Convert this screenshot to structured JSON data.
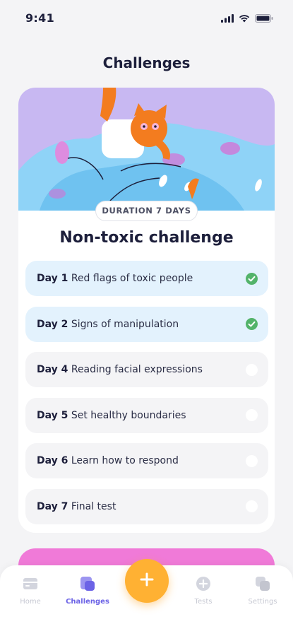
{
  "status_bar": {
    "time": "9:41",
    "icons": [
      "signal-icon",
      "wifi-icon",
      "battery-icon"
    ]
  },
  "header": {
    "title": "Challenges"
  },
  "challenge": {
    "duration_label": "DURATION 7 DAYS",
    "title": "Non-toxic challenge",
    "days": [
      {
        "day": "Day 1",
        "title": "Red flags of toxic people",
        "completed": true
      },
      {
        "day": "Day 2",
        "title": "Signs of manipulation",
        "completed": true
      },
      {
        "day": "Day 4",
        "title": "Reading facial expressions",
        "completed": false
      },
      {
        "day": "Day 5",
        "title": "Set healthy boundaries",
        "completed": false
      },
      {
        "day": "Day 6",
        "title": "Learn how to respond",
        "completed": false
      },
      {
        "day": "Day 7",
        "title": "Final test",
        "completed": false
      }
    ]
  },
  "tab_bar": {
    "tabs": [
      {
        "label": "Home",
        "icon": "home-icon",
        "active": false
      },
      {
        "label": "Challenges",
        "icon": "challenges-icon",
        "active": true
      },
      {
        "label": "Tests",
        "icon": "tests-icon",
        "active": false
      },
      {
        "label": "Settings",
        "icon": "settings-icon",
        "active": false
      }
    ],
    "fab_icon": "plus-icon"
  },
  "colors": {
    "accent": "#6c63e6",
    "fab": "#ffb133",
    "completed_check": "#53b36a",
    "completed_row": "#e3f2fd",
    "pending_row": "#f4f4f6",
    "promo_card": "#f07ad8"
  }
}
